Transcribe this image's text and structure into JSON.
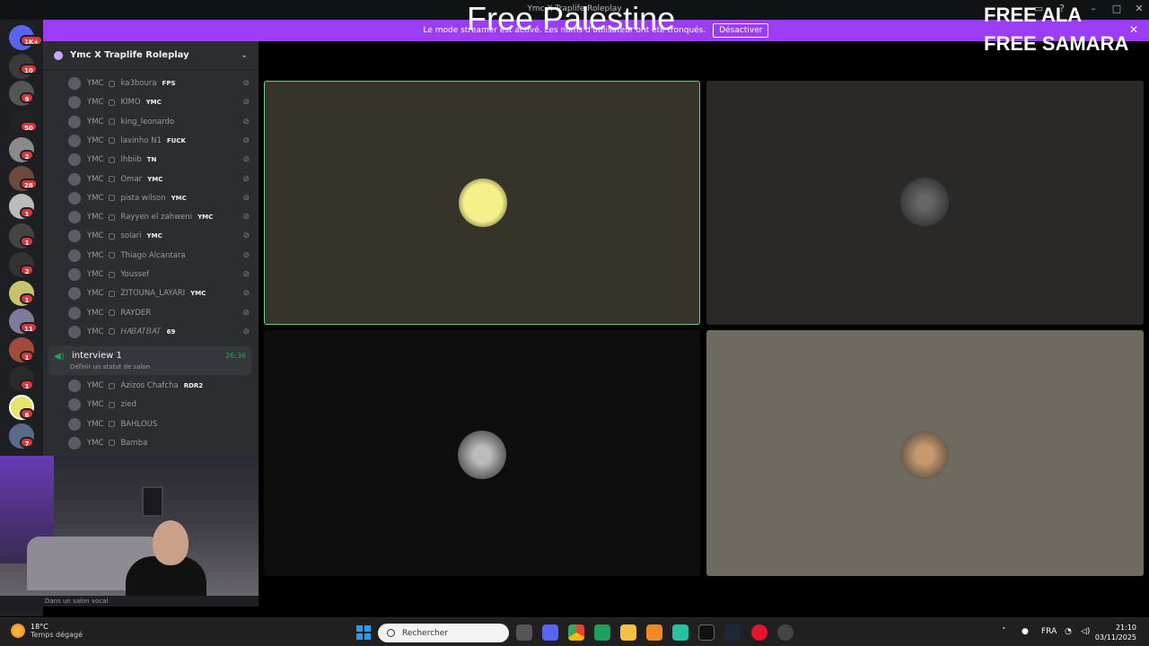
{
  "window": {
    "title": "Ymc X Traplife Roleplay"
  },
  "overlay": {
    "palestine": "Free Palestine",
    "free1": "FREE ALA",
    "free2": "FREE SAMARA"
  },
  "banner": {
    "text": "Le mode streamer est activé. Les noms d'utilisateur ont été tronqués.",
    "button": "Désactiver"
  },
  "rail": {
    "badges": [
      "1K+",
      "10",
      "9",
      "50",
      "2",
      "28",
      "1",
      "1",
      "2",
      "1",
      "11",
      "1",
      "1",
      "6",
      "7"
    ]
  },
  "server": {
    "name": "Ymc X Traplife Roleplay"
  },
  "members": [
    {
      "tag": "YMC",
      "name": "ka3boura",
      "badge": "FPS"
    },
    {
      "tag": "YMC",
      "name": "KIMO",
      "badge": "YMC"
    },
    {
      "tag": "YMC",
      "name": "king_leonardo",
      "badge": ""
    },
    {
      "tag": "YMC",
      "name": "lavinho N1",
      "badge": "FUCK"
    },
    {
      "tag": "YMC",
      "name": "lhbiib",
      "badge": "TN"
    },
    {
      "tag": "YMC",
      "name": "Omar",
      "badge": "YMC"
    },
    {
      "tag": "YMC",
      "name": "pista wilson",
      "badge": "YMC"
    },
    {
      "tag": "YMC",
      "name": "Rayyen el zahweni",
      "badge": "YMC"
    },
    {
      "tag": "YMC",
      "name": "solari",
      "badge": "YMC"
    },
    {
      "tag": "YMC",
      "name": "Thiago Alcantara",
      "badge": ""
    },
    {
      "tag": "YMC",
      "name": "Youssef",
      "badge": ""
    },
    {
      "tag": "YMC",
      "name": "ZITOUNA_LAYARI",
      "badge": "YMC"
    },
    {
      "tag": "YMC",
      "name": "RAYDER",
      "badge": ""
    },
    {
      "tag": "YMC",
      "name": "𝐻𝐴𝐵𝐴𝑇𝐵𝐴𝑇",
      "badge": "69"
    }
  ],
  "voice_channel": {
    "name": "interview 1",
    "time": "26:36",
    "status": "Définir un statut de salon"
  },
  "voice_members": [
    {
      "tag": "YMC",
      "name": "Azizos Chafcha",
      "badge": "RDR2"
    },
    {
      "tag": "YMC",
      "name": "zied",
      "badge": ""
    },
    {
      "tag": "YMC",
      "name": "BAHLOUS",
      "badge": ""
    },
    {
      "tag": "YMC",
      "name": "Bamba",
      "badge": ""
    }
  ],
  "webcam": {
    "status": "Dans un salon vocal"
  },
  "colors": {
    "banner": "#9b3df5",
    "speaking": "#23a559",
    "tile1": "#36332b",
    "tile2": "#2a2928",
    "tile3": "#0e0e0e",
    "tile4": "#6e6a60"
  },
  "taskbar": {
    "weather_temp": "18°C",
    "weather_desc": "Temps dégagé",
    "search": "Rechercher",
    "lang": "FRA",
    "time": "21:10",
    "date": "03/11/2025"
  },
  "icons": [
    "discord-icon",
    "chrome-icon",
    "explorer-icon",
    "steam-icon",
    "opera-icon",
    "mic-icon",
    "wifi-icon",
    "volume-icon"
  ]
}
